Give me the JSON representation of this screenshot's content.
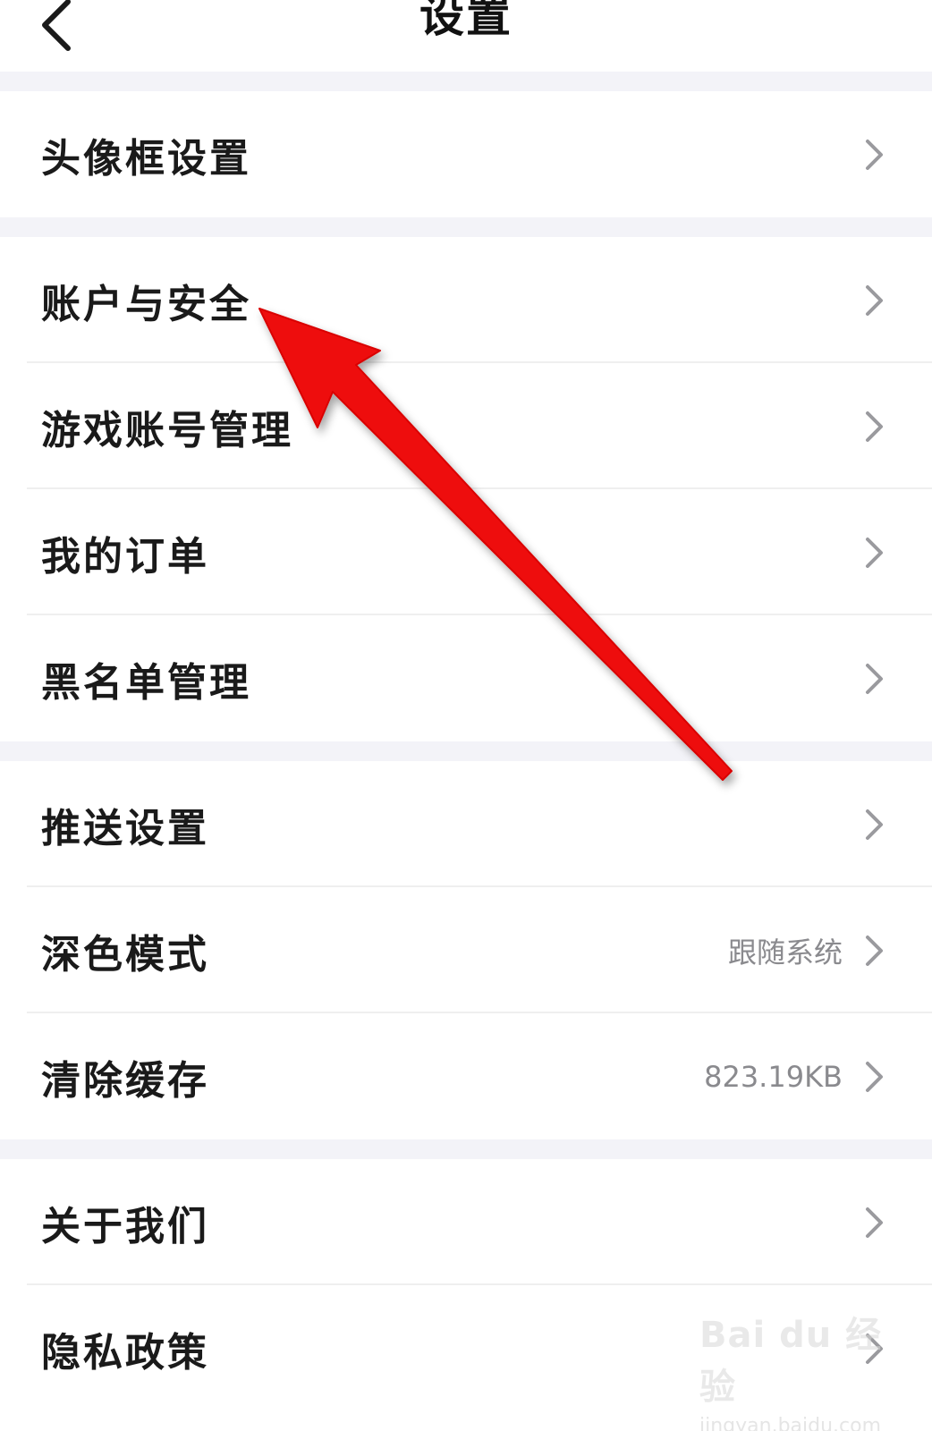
{
  "header": {
    "title": "设置",
    "back_icon": "chevron-left-icon"
  },
  "sections": [
    {
      "items": [
        {
          "id": "avatar-frame",
          "label": "头像框设置"
        }
      ]
    },
    {
      "items": [
        {
          "id": "account-security",
          "label": "账户与安全"
        },
        {
          "id": "game-accounts",
          "label": "游戏账号管理"
        },
        {
          "id": "my-orders",
          "label": "我的订单"
        },
        {
          "id": "blacklist",
          "label": "黑名单管理"
        }
      ]
    },
    {
      "items": [
        {
          "id": "push-settings",
          "label": "推送设置"
        },
        {
          "id": "dark-mode",
          "label": "深色模式",
          "value": "跟随系统"
        },
        {
          "id": "clear-cache",
          "label": "清除缓存",
          "value": "823.19KB"
        }
      ]
    },
    {
      "items": [
        {
          "id": "about-us",
          "label": "关于我们"
        },
        {
          "id": "privacy-policy",
          "label": "隐私政策"
        }
      ]
    }
  ],
  "annotation": {
    "arrow_color": "#ee1111"
  },
  "watermark": {
    "logo": "Bai du 经验",
    "url": "jingyan.baidu.com"
  }
}
